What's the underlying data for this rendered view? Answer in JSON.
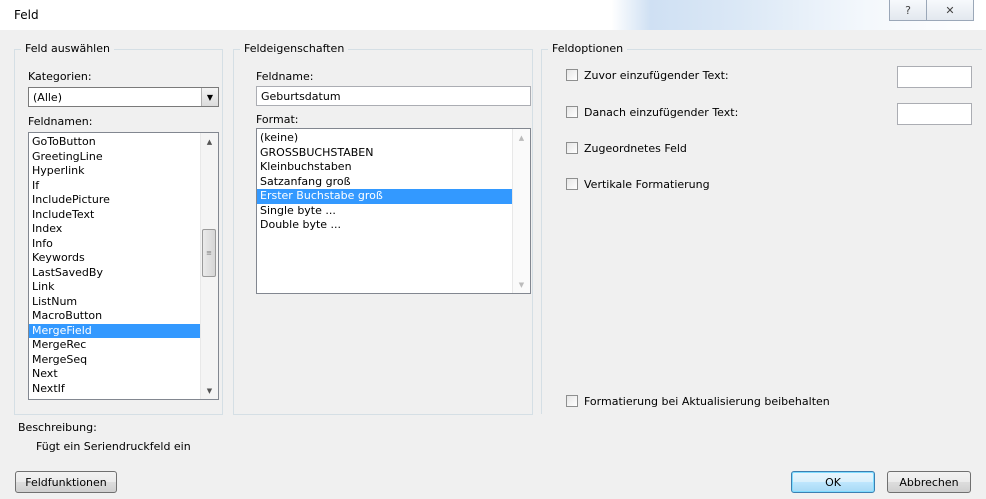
{
  "window": {
    "title": "Feld",
    "help_icon": "?",
    "close_icon": "✕"
  },
  "feld_auswaehlen": {
    "group_title": "Feld auswählen",
    "kategorien_label": "Kategorien:",
    "kategorien_value": "(Alle)",
    "feldnamen_label": "Feldnamen:",
    "feldnamen": [
      "GoToButton",
      "GreetingLine",
      "Hyperlink",
      "If",
      "IncludePicture",
      "IncludeText",
      "Index",
      "Info",
      "Keywords",
      "LastSavedBy",
      "Link",
      "ListNum",
      "MacroButton",
      "MergeField",
      "MergeRec",
      "MergeSeq",
      "Next",
      "NextIf"
    ],
    "selected": "MergeField"
  },
  "feldeigenschaften": {
    "group_title": "Feldeigenschaften",
    "feldname_label": "Feldname:",
    "feldname_value": "Geburtsdatum",
    "format_label": "Format:",
    "formats": [
      "(keine)",
      "GROSSBUCHSTABEN",
      "Kleinbuchstaben",
      "Satzanfang groß",
      "Erster Buchstabe groß",
      "Single byte ...",
      "Double byte ..."
    ],
    "selected": "Erster Buchstabe groß"
  },
  "feldoptionen": {
    "group_title": "Feldoptionen",
    "zuvor_label": "Zuvor einzufügender Text:",
    "zuvor_value": "",
    "danach_label": "Danach einzufügender Text:",
    "danach_value": "",
    "zugeordnet_label": "Zugeordnetes Feld",
    "vertikal_label": "Vertikale Formatierung",
    "beibehalten_label": "Formatierung bei Aktualisierung beibehalten"
  },
  "beschreibung": {
    "label": "Beschreibung:",
    "text": "Fügt ein Seriendruckfeld ein"
  },
  "buttons": {
    "feldfunktionen": "Feldfunktionen",
    "ok": "OK",
    "abbrechen": "Abbrechen"
  },
  "colors": {
    "selection": "#3399ff",
    "background": "#f0f0f0"
  }
}
